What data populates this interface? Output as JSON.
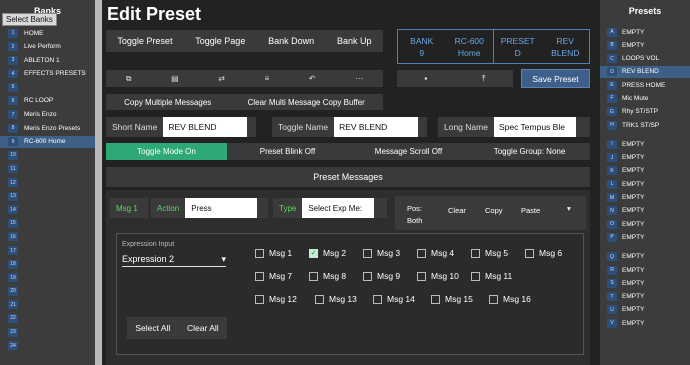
{
  "banks": {
    "title": "Banks",
    "select_label": "Select Banks",
    "items": [
      {
        "num": "1",
        "label": "HOME"
      },
      {
        "num": "2",
        "label": "Live Perform"
      },
      {
        "num": "3",
        "label": "ABLETON 1"
      },
      {
        "num": "4",
        "label": "EFFECTS PRESETS"
      },
      {
        "num": "5",
        "label": ""
      },
      {
        "num": "6",
        "label": "RC LOOP"
      },
      {
        "num": "7",
        "label": "Meris Enzo"
      },
      {
        "num": "8",
        "label": "Meris Enzo Presets"
      },
      {
        "num": "9",
        "label": "RC-600 Home"
      },
      {
        "num": "10",
        "label": ""
      },
      {
        "num": "11",
        "label": ""
      },
      {
        "num": "12",
        "label": ""
      },
      {
        "num": "13",
        "label": ""
      },
      {
        "num": "14",
        "label": ""
      },
      {
        "num": "15",
        "label": ""
      },
      {
        "num": "16",
        "label": ""
      },
      {
        "num": "17",
        "label": ""
      },
      {
        "num": "18",
        "label": ""
      },
      {
        "num": "19",
        "label": ""
      },
      {
        "num": "20",
        "label": ""
      },
      {
        "num": "21",
        "label": ""
      },
      {
        "num": "22",
        "label": ""
      },
      {
        "num": "23",
        "label": ""
      },
      {
        "num": "24",
        "label": ""
      }
    ]
  },
  "header": {
    "title": "Edit Preset"
  },
  "toolbar": {
    "toggle_preset": "Toggle Preset",
    "toggle_page": "Toggle Page",
    "bank_down": "Bank Down",
    "bank_up": "Bank Up"
  },
  "bank_info": {
    "bank_label": "BANK",
    "bank_num": "9",
    "bank_name_label": "RC-600",
    "bank_name": "Home",
    "preset_label": "PRESET",
    "preset_letter": "D",
    "preset_name_label": "REV",
    "preset_name": "BLEND"
  },
  "icons": {
    "copy": "⧉",
    "clipboard": "▤",
    "swap": "⇄",
    "list": "≡",
    "undo": "↶",
    "more": "⋯",
    "save": "▪",
    "upload": "⤒"
  },
  "save_preset": "Save Preset",
  "copy_bar": {
    "copy_multiple": "Copy Multiple Messages",
    "clear_buffer": "Clear Multi Message Copy Buffer"
  },
  "fields": {
    "short_name_label": "Short Name",
    "short_name": "REV BLEND",
    "toggle_name_label": "Toggle Name",
    "toggle_name": "REV BLEND",
    "long_name_label": "Long Name",
    "long_name": "Spec Tempus Ble"
  },
  "mode_bar": {
    "toggle_mode": "Toggle Mode On",
    "blink": "Preset Blink Off",
    "scroll": "Message Scroll Off",
    "group": "Toggle Group: None"
  },
  "preset_messages": {
    "header": "Preset Messages",
    "msg": "Msg 1",
    "action_label": "Action",
    "action": "Press",
    "type_label": "Type",
    "type": "Select Exp Me:",
    "pos_label": "Pos:",
    "pos_value": "Both",
    "clear": "Clear",
    "copy": "Copy",
    "paste": "Paste",
    "dropdown": "▾"
  },
  "expression": {
    "label": "Expression Input",
    "value": "Expression 2",
    "msgs": [
      {
        "label": "Msg 1",
        "checked": false
      },
      {
        "label": "Msg 2",
        "checked": true
      },
      {
        "label": "Msg 3",
        "checked": false
      },
      {
        "label": "Msg 4",
        "checked": false
      },
      {
        "label": "Msg 5",
        "checked": false
      },
      {
        "label": "Msg 6",
        "checked": false
      },
      {
        "label": "Msg 7",
        "checked": false
      },
      {
        "label": "Msg 8",
        "checked": false
      },
      {
        "label": "Msg 9",
        "checked": false
      },
      {
        "label": "Msg 10",
        "checked": false
      },
      {
        "label": "Msg 11",
        "checked": false
      },
      {
        "label": "Msg 12",
        "checked": false
      },
      {
        "label": "Msg 13",
        "checked": false
      },
      {
        "label": "Msg 14",
        "checked": false
      },
      {
        "label": "Msg 15",
        "checked": false
      },
      {
        "label": "Msg 16",
        "checked": false
      }
    ],
    "select_all": "Select All",
    "clear_all": "Clear All"
  },
  "presets": {
    "title": "Presets",
    "groups": [
      [
        {
          "num": "A",
          "label": "EMPTY"
        },
        {
          "num": "B",
          "label": "EMPTY"
        },
        {
          "num": "C",
          "label": "LOOPS VOL"
        },
        {
          "num": "D",
          "label": "REV BLEND"
        },
        {
          "num": "E",
          "label": "PRESS HOME"
        },
        {
          "num": "F",
          "label": "Mic Mute"
        },
        {
          "num": "G",
          "label": "Rhy ST/STP"
        },
        {
          "num": "H",
          "label": "TRK1 ST/SP"
        }
      ],
      [
        {
          "num": "I",
          "label": "EMPTY"
        },
        {
          "num": "J",
          "label": "EMPTY"
        },
        {
          "num": "K",
          "label": "EMPTY"
        },
        {
          "num": "L",
          "label": "EMPTY"
        },
        {
          "num": "M",
          "label": "EMPTY"
        },
        {
          "num": "N",
          "label": "EMPTY"
        },
        {
          "num": "O",
          "label": "EMPTY"
        },
        {
          "num": "P",
          "label": "EMPTY"
        }
      ],
      [
        {
          "num": "Q",
          "label": "EMPTY"
        },
        {
          "num": "R",
          "label": "EMPTY"
        },
        {
          "num": "S",
          "label": "EMPTY"
        },
        {
          "num": "T",
          "label": "EMPTY"
        },
        {
          "num": "U",
          "label": "EMPTY"
        },
        {
          "num": "V",
          "label": "EMPTY"
        }
      ]
    ]
  }
}
